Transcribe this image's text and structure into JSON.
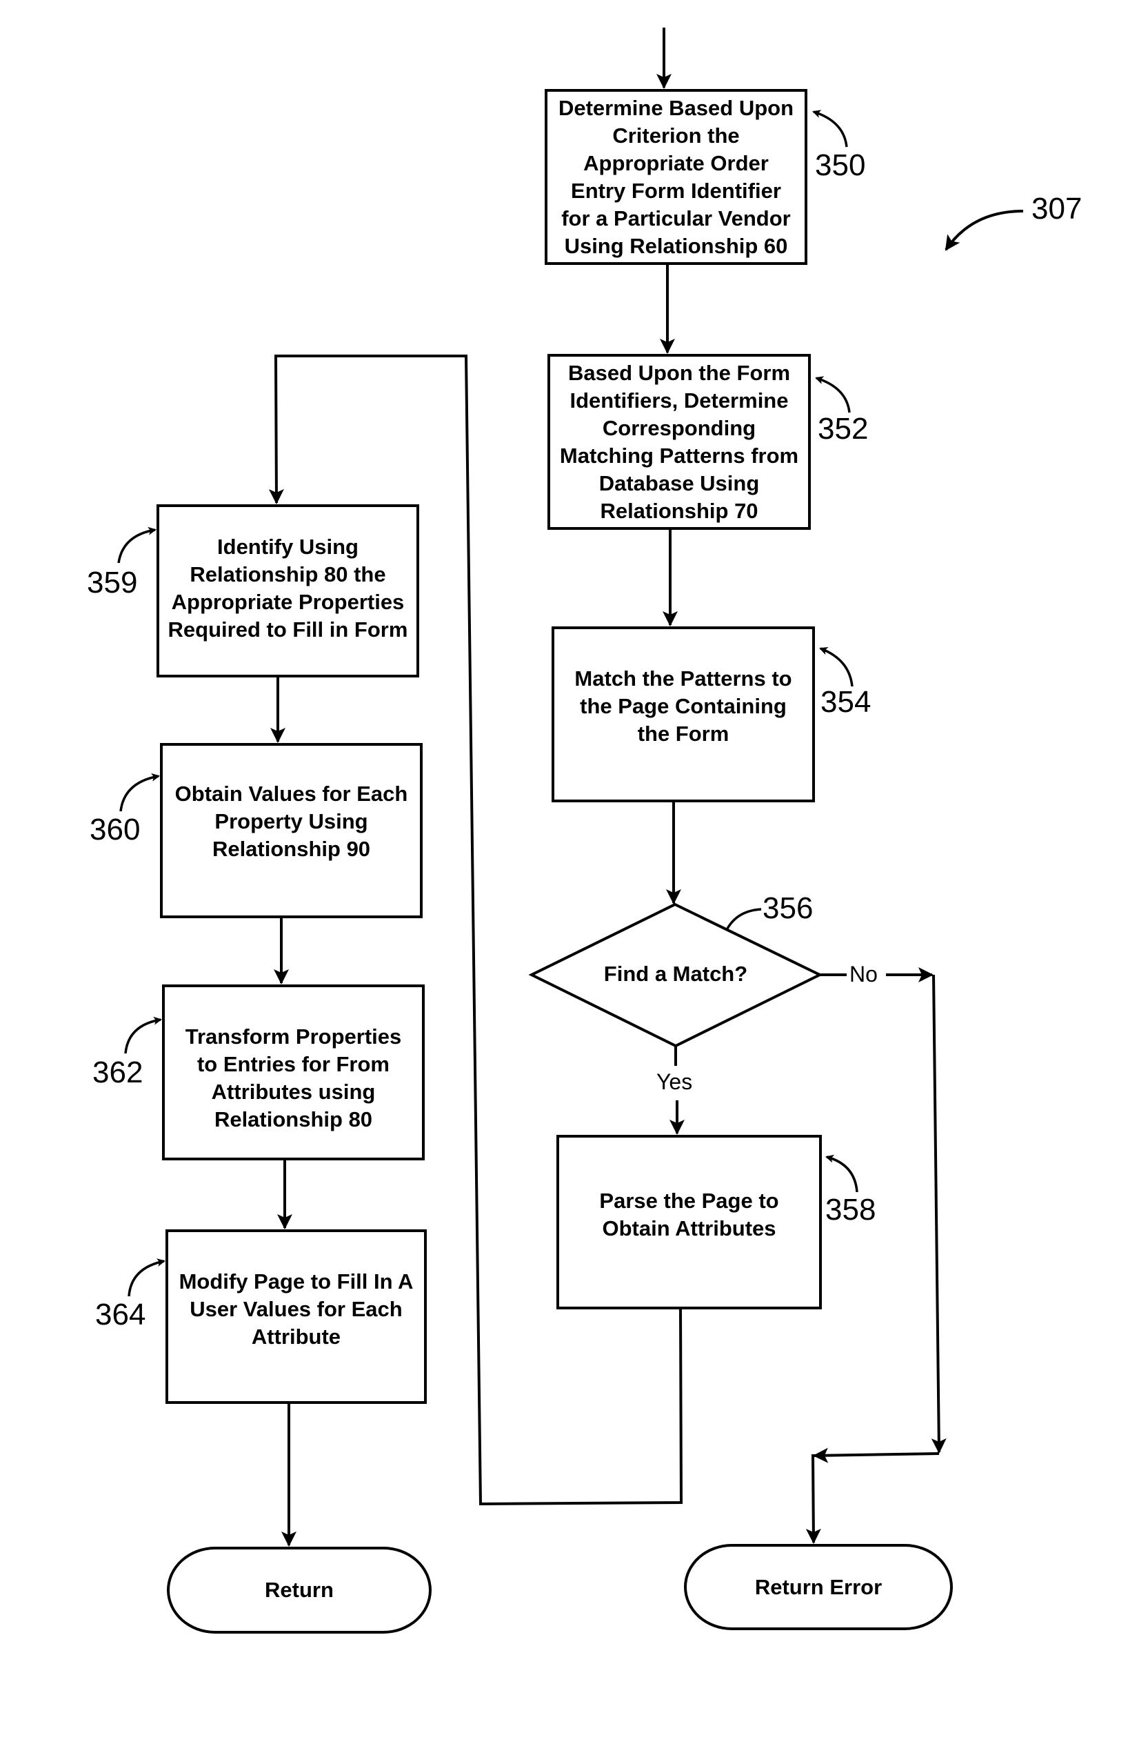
{
  "figure": {
    "ref": "307"
  },
  "steps": {
    "s350": {
      "ref": "350",
      "text": "Determine Based Upon\nCriterion the\nAppropriate Order\nEntry Form Identifier\nfor a Particular Vendor\nUsing Relationship 60"
    },
    "s352": {
      "ref": "352",
      "text": "Based Upon the Form\nIdentifiers, Determine\nCorresponding\nMatching Patterns from\nDatabase Using\nRelationship 70"
    },
    "s354": {
      "ref": "354",
      "text": "Match the Patterns to\nthe Page Containing\nthe Form"
    },
    "s356": {
      "ref": "356",
      "text": "Find a Match?",
      "yes_label": "Yes",
      "no_label": "No"
    },
    "s358": {
      "ref": "358",
      "text": "Parse the Page to\nObtain Attributes"
    },
    "s359": {
      "ref": "359",
      "text": "Identify Using\nRelationship 80 the\nAppropriate Properties\nRequired to Fill in Form"
    },
    "s360": {
      "ref": "360",
      "text": "Obtain Values for Each\nProperty Using\nRelationship 90"
    },
    "s362": {
      "ref": "362",
      "text": "Transform Properties\nto Entries for From\nAttributes using\nRelationship 80"
    },
    "s364": {
      "ref": "364",
      "text": "Modify Page to Fill In A\nUser Values for Each\nAttribute"
    }
  },
  "terminals": {
    "return": "Return",
    "return_error": "Return Error"
  }
}
